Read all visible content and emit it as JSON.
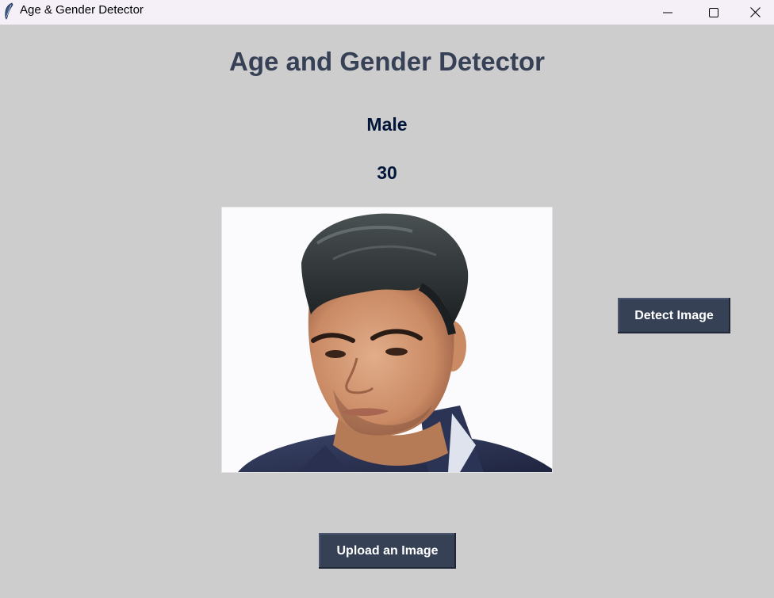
{
  "window": {
    "title": "Age & Gender Detector",
    "icon": "feather-icon"
  },
  "controls": {
    "minimize_icon": "minimize-icon",
    "maximize_icon": "maximize-icon",
    "close_icon": "close-icon"
  },
  "main": {
    "heading": "Age and Gender Detector",
    "gender": "Male",
    "age": "30",
    "photo_icon": "face-photo"
  },
  "buttons": {
    "detect_label": "Detect Image",
    "upload_label": "Upload an Image"
  },
  "colors": {
    "background": "#cdcdcd",
    "heading": "#364156",
    "result_text": "#011638",
    "button_bg": "#364156",
    "button_text": "#ffffff",
    "titlebar": "#f5f0f8"
  }
}
